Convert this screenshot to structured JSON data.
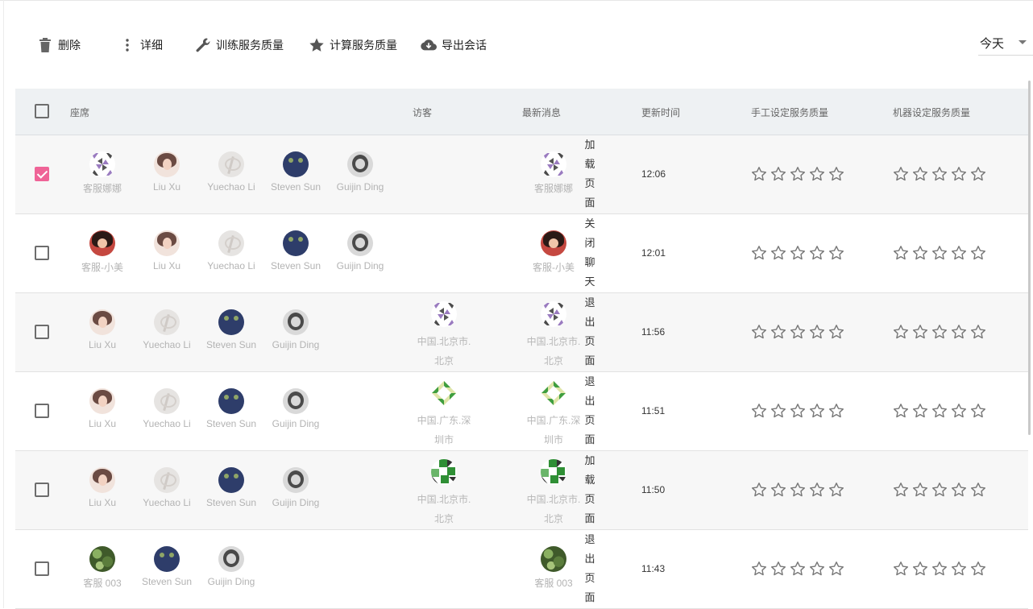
{
  "toolbar": {
    "delete_label": "删除",
    "details_label": "详细",
    "train_label": "训练服务质量",
    "compute_label": "计算服务质量",
    "export_label": "导出会话"
  },
  "range_select": {
    "value": "今天"
  },
  "table": {
    "headers": {
      "agents": "座席",
      "visitor": "访客",
      "latest_message": "最新消息",
      "updated_time": "更新时间",
      "manual_quality": "手工设定服务质量",
      "machine_quality": "机器设定服务质量"
    },
    "rows": [
      {
        "checked": true,
        "agents": [
          "客服娜娜",
          "Liu Xu",
          "Yuechao Li",
          "Steven Sun",
          "Guijin Ding"
        ],
        "visitor": "",
        "latest_sender": "客服娜娜",
        "latest_message": [
          "加",
          "载",
          "页",
          "面"
        ],
        "time": "12:06",
        "manual_stars": 0,
        "machine_stars": 0
      },
      {
        "checked": false,
        "agents": [
          "客服-小美",
          "Liu Xu",
          "Yuechao Li",
          "Steven Sun",
          "Guijin Ding"
        ],
        "visitor": "",
        "latest_sender": "客服-小美",
        "latest_message": [
          "关",
          "闭",
          "聊",
          "天"
        ],
        "time": "12:01",
        "manual_stars": 0,
        "machine_stars": 0
      },
      {
        "checked": false,
        "agents": [
          "Liu Xu",
          "Yuechao Li",
          "Steven Sun",
          "Guijin Ding"
        ],
        "visitor": [
          "中国.北京市.",
          "北京"
        ],
        "latest_sender": [
          "中国.北京市.",
          "北京"
        ],
        "latest_message": [
          "退",
          "出",
          "页",
          "面"
        ],
        "time": "11:56",
        "manual_stars": 0,
        "machine_stars": 0
      },
      {
        "checked": false,
        "agents": [
          "Liu Xu",
          "Yuechao Li",
          "Steven Sun",
          "Guijin Ding"
        ],
        "visitor": [
          "中国.广东.深",
          "圳市"
        ],
        "latest_sender": [
          "中国.广东.深",
          "圳市"
        ],
        "latest_message": [
          "退",
          "出",
          "页",
          "面"
        ],
        "time": "11:51",
        "manual_stars": 0,
        "machine_stars": 0
      },
      {
        "checked": false,
        "agents": [
          "Liu Xu",
          "Yuechao Li",
          "Steven Sun",
          "Guijin Ding"
        ],
        "visitor": [
          "中国.北京市.",
          "北京"
        ],
        "latest_sender": [
          "中国.北京市.",
          "北京"
        ],
        "latest_message": [
          "加",
          "载",
          "页",
          "面"
        ],
        "time": "11:50",
        "manual_stars": 0,
        "machine_stars": 0
      },
      {
        "checked": false,
        "agents": [
          "客服 003",
          "Steven Sun",
          "Guijin Ding"
        ],
        "visitor": "",
        "latest_sender": "客服 003",
        "latest_message": [
          "退",
          "出",
          "页",
          "面"
        ],
        "time": "11:43",
        "manual_stars": 0,
        "machine_stars": 0
      }
    ]
  }
}
